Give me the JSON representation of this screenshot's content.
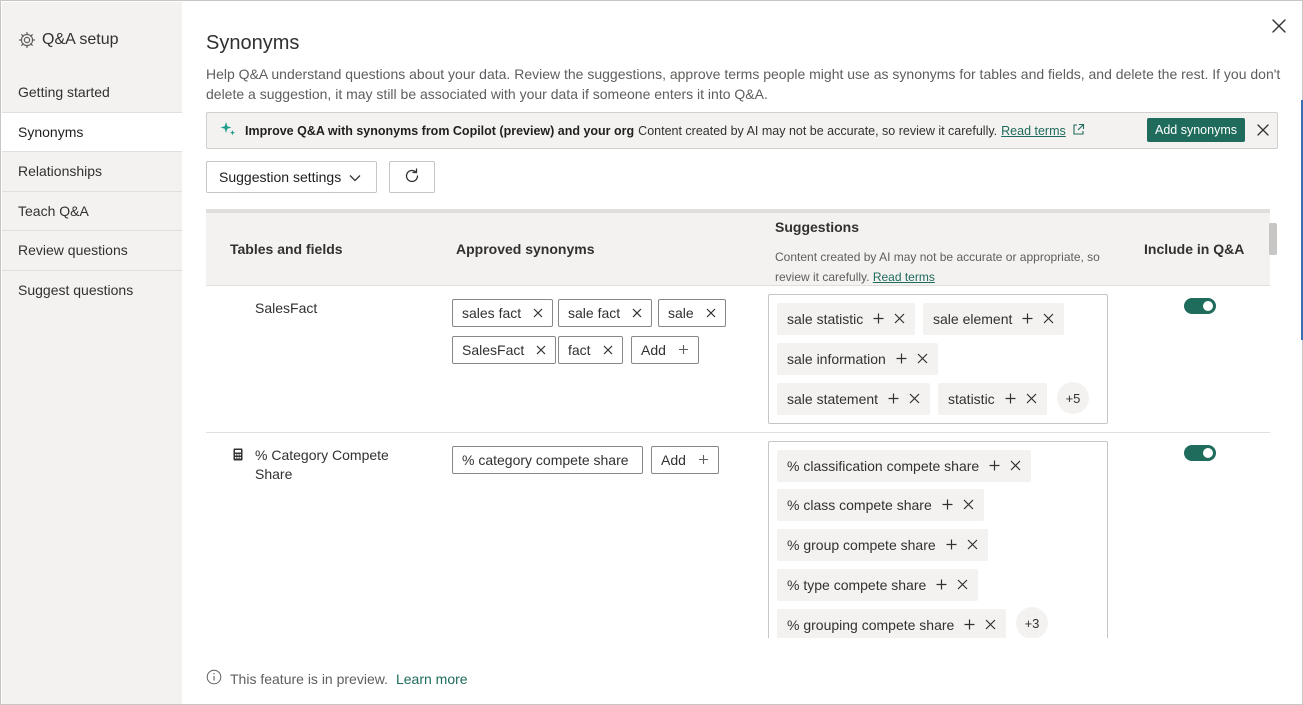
{
  "sidebar": {
    "title": "Q&A setup",
    "items": [
      {
        "label": "Getting started"
      },
      {
        "label": "Synonyms"
      },
      {
        "label": "Relationships"
      },
      {
        "label": "Teach Q&A"
      },
      {
        "label": "Review questions"
      },
      {
        "label": "Suggest questions"
      }
    ],
    "active_index": 1
  },
  "page": {
    "title": "Synonyms",
    "description": "Help Q&A understand questions about your data. Review the suggestions, approve terms people might use as synonyms for tables and fields, and delete the rest. If you don't delete a suggestion, it may still be associated with your data if someone enters it into Q&A."
  },
  "banner": {
    "bold_text": "Improve Q&A with synonyms from Copilot (preview) and your org",
    "text": "Content created by AI may not be accurate, so review it carefully.",
    "link": "Read terms",
    "button": "Add synonyms"
  },
  "toolbar": {
    "settings_label": "Suggestion settings"
  },
  "table": {
    "headers": {
      "fields": "Tables and fields",
      "approved": "Approved synonyms",
      "suggestions": "Suggestions",
      "suggestions_note": "Content created by AI may not be accurate or appropriate, so review it carefully.",
      "suggestions_link": "Read terms",
      "include": "Include in Q&A"
    },
    "rows": [
      {
        "name": "SalesFact",
        "approved": [
          "sales fact",
          "sale fact",
          "sale",
          "SalesFact",
          "fact"
        ],
        "add_label": "Add",
        "suggestions": [
          "sale statistic",
          "sale element",
          "sale information",
          "sale statement",
          "statistic"
        ],
        "more": "+5",
        "include": true
      },
      {
        "name": "% Category Compete Share",
        "approved": [
          "% category compete share"
        ],
        "add_label": "Add",
        "suggestions": [
          "% classification compete share",
          "% class compete share",
          "% group compete share",
          "% type compete share",
          "% grouping compete share"
        ],
        "more": "+3",
        "include": true
      }
    ]
  },
  "footer": {
    "text": "This feature is in preview.",
    "link": "Learn more"
  },
  "colors": {
    "accent": "#1f6b5c",
    "sidebar_bg": "#f3f2f1",
    "chip_bg": "#f3f2f1"
  },
  "icons": [
    "gear-icon",
    "close-icon",
    "sparkle-icon",
    "external-link-icon",
    "chevron-down-icon",
    "refresh-icon",
    "calculator-icon",
    "remove-icon",
    "add-icon",
    "info-icon"
  ]
}
